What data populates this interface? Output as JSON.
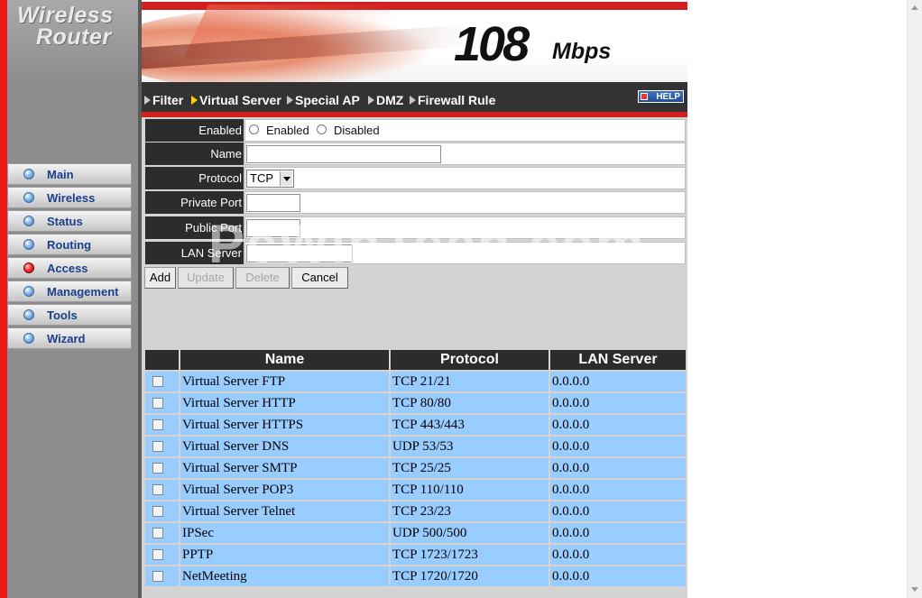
{
  "logo": {
    "line1": "Wireless",
    "line2": "Router"
  },
  "banner": {
    "speed": "108",
    "unit": "Mbps"
  },
  "sidebar": {
    "items": [
      {
        "label": "Main",
        "active": false
      },
      {
        "label": "Wireless",
        "active": false
      },
      {
        "label": "Status",
        "active": false
      },
      {
        "label": "Routing",
        "active": false
      },
      {
        "label": "Access",
        "active": true
      },
      {
        "label": "Management",
        "active": false
      },
      {
        "label": "Tools",
        "active": false
      },
      {
        "label": "Wizard",
        "active": false
      }
    ]
  },
  "nav": {
    "items": [
      "Filter",
      "Virtual Server",
      "Special AP",
      "DMZ",
      "Firewall Rule"
    ],
    "active": "Virtual Server",
    "help_label": "HELP"
  },
  "form": {
    "enabled_label": "Enabled",
    "enabled_option": "Enabled",
    "disabled_option": "Disabled",
    "name_label": "Name",
    "name_value": "",
    "protocol_label": "Protocol",
    "protocol_value": "TCP",
    "private_port_label": "Private Port",
    "private_port_value": "",
    "public_port_label": "Public Port",
    "public_port_value": "",
    "lan_server_label": "LAN Server",
    "lan_server_value": ""
  },
  "buttons": {
    "add": "Add",
    "update": "Update",
    "delete": "Delete",
    "cancel": "Cancel"
  },
  "watermark": "PcWinTech.com",
  "table": {
    "headers": [
      "Name",
      "Protocol",
      "LAN Server"
    ],
    "rows": [
      {
        "name": "Virtual Server FTP",
        "protocol": "TCP 21/21",
        "lan_server": "0.0.0.0"
      },
      {
        "name": "Virtual Server HTTP",
        "protocol": "TCP 80/80",
        "lan_server": "0.0.0.0"
      },
      {
        "name": "Virtual Server HTTPS",
        "protocol": "TCP 443/443",
        "lan_server": "0.0.0.0"
      },
      {
        "name": "Virtual Server DNS",
        "protocol": "UDP 53/53",
        "lan_server": "0.0.0.0"
      },
      {
        "name": "Virtual Server SMTP",
        "protocol": "TCP 25/25",
        "lan_server": "0.0.0.0"
      },
      {
        "name": "Virtual Server POP3",
        "protocol": "TCP 110/110",
        "lan_server": "0.0.0.0"
      },
      {
        "name": "Virtual Server Telnet",
        "protocol": "TCP 23/23",
        "lan_server": "0.0.0.0"
      },
      {
        "name": "IPSec",
        "protocol": "UDP 500/500",
        "lan_server": "0.0.0.0"
      },
      {
        "name": "PPTP",
        "protocol": "TCP 1723/1723",
        "lan_server": "0.0.0.0"
      },
      {
        "name": "NetMeeting",
        "protocol": "TCP 1720/1720",
        "lan_server": "0.0.0.0"
      }
    ]
  },
  "colors": {
    "accent_red": "#d21f1f",
    "header_dark": "#2c2c2c",
    "row_blue": "#99ccff",
    "menu_text": "#1b3f8c"
  }
}
